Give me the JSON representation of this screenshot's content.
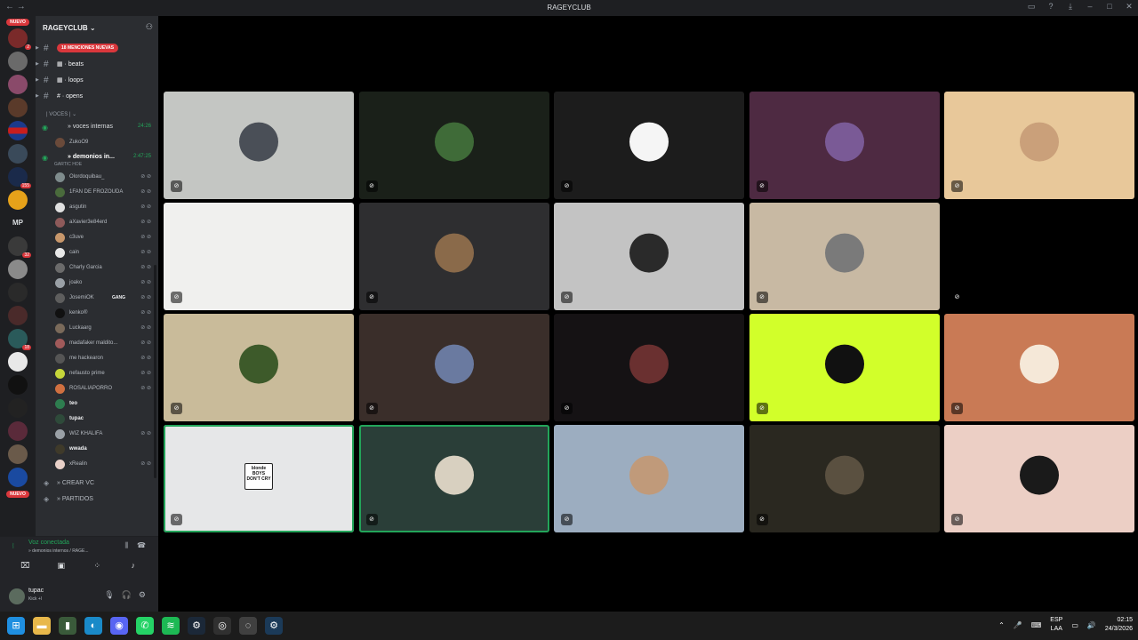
{
  "window": {
    "title": "RAGEYCLUB",
    "nav_back": "←",
    "nav_fwd": "→"
  },
  "guilds": {
    "badge_top": "NUEVO",
    "badge_bottom": "NUEVO",
    "mp_label": "MP",
    "counts": [
      "2",
      "155",
      "32",
      "18"
    ]
  },
  "server": {
    "name": "RAGEYCLUB ⌄"
  },
  "channels": [
    {
      "label": "18 MENCIONES NUEVAS",
      "is_mention": true
    },
    {
      "label": "▦ · beats"
    },
    {
      "label": "▦ · loops"
    },
    {
      "label": "# · opens"
    }
  ],
  "category": {
    "label": "| VOCES | ⌄"
  },
  "voice_channels": {
    "internas": {
      "name": "» voces internas",
      "time": "24:26",
      "member": "ZukoO9"
    },
    "demonios": {
      "name": "» demonios in...",
      "time": "2:47:25",
      "activity": "GARTIC HOE"
    }
  },
  "members": [
    {
      "name": "Olordoquibau_",
      "color": "#7f8c8d",
      "bright": false
    },
    {
      "name": "1FAN DE FROZOUDA",
      "color": "#4a6b3c",
      "bright": false
    },
    {
      "name": "asgutin",
      "color": "#e0e0e0",
      "bright": false
    },
    {
      "name": "aXavier3e84erd",
      "color": "#8e5a5a",
      "bright": false
    },
    {
      "name": "c3uve",
      "color": "#c8976b",
      "bright": false
    },
    {
      "name": "cain",
      "color": "#e8e8e8",
      "bright": false
    },
    {
      "name": "Charly Garcia",
      "color": "#6b6b6b",
      "bright": false
    },
    {
      "name": "joako",
      "color": "#9aa0a6",
      "bright": false
    },
    {
      "name": "JosemiOK",
      "color": "#5e5e5e",
      "bright": false,
      "tag": "GANG"
    },
    {
      "name": "kenko®",
      "color": "#111111",
      "bright": false
    },
    {
      "name": "Luckaarg",
      "color": "#7a6a5a",
      "bright": false
    },
    {
      "name": "madafaker maldito...",
      "color": "#a05a5a",
      "bright": false
    },
    {
      "name": "me hackearon",
      "color": "#555555",
      "bright": false
    },
    {
      "name": "nefausto prime",
      "color": "#c6d63a",
      "bright": false
    },
    {
      "name": "ROSALIAPORRO",
      "color": "#d07040",
      "bright": false
    },
    {
      "name": "teo",
      "color": "#2e7d4f",
      "bright": true
    },
    {
      "name": "tupac",
      "color": "#2e4a3a",
      "bright": true
    },
    {
      "name": "WIZ KHALIFA",
      "color": "#9aa0a6",
      "bright": false
    },
    {
      "name": "wwada",
      "color": "#3f3a2a",
      "bright": true
    },
    {
      "name": "xRealin",
      "color": "#e8d0c8",
      "bright": false
    }
  ],
  "extra_channels": [
    {
      "label": "» CREAR VC"
    },
    {
      "label": "» PARTIDOS"
    }
  ],
  "voice_panel": {
    "status": "Voz conectada",
    "location": "» demonios internos / RAGE..."
  },
  "user_panel": {
    "name": "tupac",
    "status": "Kick +l"
  },
  "tiles": [
    {
      "bg": "#c4c6c3",
      "av": "#4a4f57",
      "speaking": false
    },
    {
      "bg": "#1a2019",
      "av": "#3f6b38",
      "speaking": false
    },
    {
      "bg": "#1c1c1c",
      "av": "#f5f5f5",
      "speaking": false
    },
    {
      "bg": "#4e2a42",
      "av": "#7a5a96",
      "speaking": false
    },
    {
      "bg": "#e8c89a",
      "av": "#caa07a",
      "speaking": false
    },
    {
      "bg": "#f0f0ee",
      "av": "#f0f0ee",
      "speaking": false
    },
    {
      "bg": "#2e2e30",
      "av": "#8a6a4a",
      "speaking": false
    },
    {
      "bg": "#c3c3c3",
      "av": "#2a2a2a",
      "speaking": false
    },
    {
      "bg": "#c8b9a3",
      "av": "#7a7a7a",
      "speaking": false
    },
    {
      "bg": "#000000",
      "av": "#000000",
      "speaking": false
    },
    {
      "bg": "#c9bb9a",
      "av": "#3d5a2a",
      "speaking": false
    },
    {
      "bg": "#3a2e2a",
      "av": "#6a7aa0",
      "speaking": false
    },
    {
      "bg": "#151214",
      "av": "#6a3030",
      "speaking": false
    },
    {
      "bg": "#d2ff2a",
      "av": "#111111",
      "speaking": false
    },
    {
      "bg": "#c97a55",
      "av": "#f5e8d8",
      "speaking": false
    },
    {
      "bg": "#e6e7e8",
      "av": "#222222",
      "speaking": true,
      "text": "blonde BOYS DON'T CRY"
    },
    {
      "bg": "#2a3e38",
      "av": "#d8d0c0",
      "speaking": true
    },
    {
      "bg": "#9cadc0",
      "av": "#c09a7a",
      "speaking": false
    },
    {
      "bg": "#2a2820",
      "av": "#5a5040",
      "speaking": false
    },
    {
      "bg": "#eccfc5",
      "av": "#1a1a1a",
      "speaking": false
    }
  ],
  "taskbar": {
    "lang_top": "ESP",
    "lang_bottom": "LAA",
    "time": "02:15",
    "date": "24/3/2026"
  },
  "colors": {
    "speaking": "#23a55a",
    "mention": "#da373c",
    "sidebar": "#2b2d31"
  }
}
